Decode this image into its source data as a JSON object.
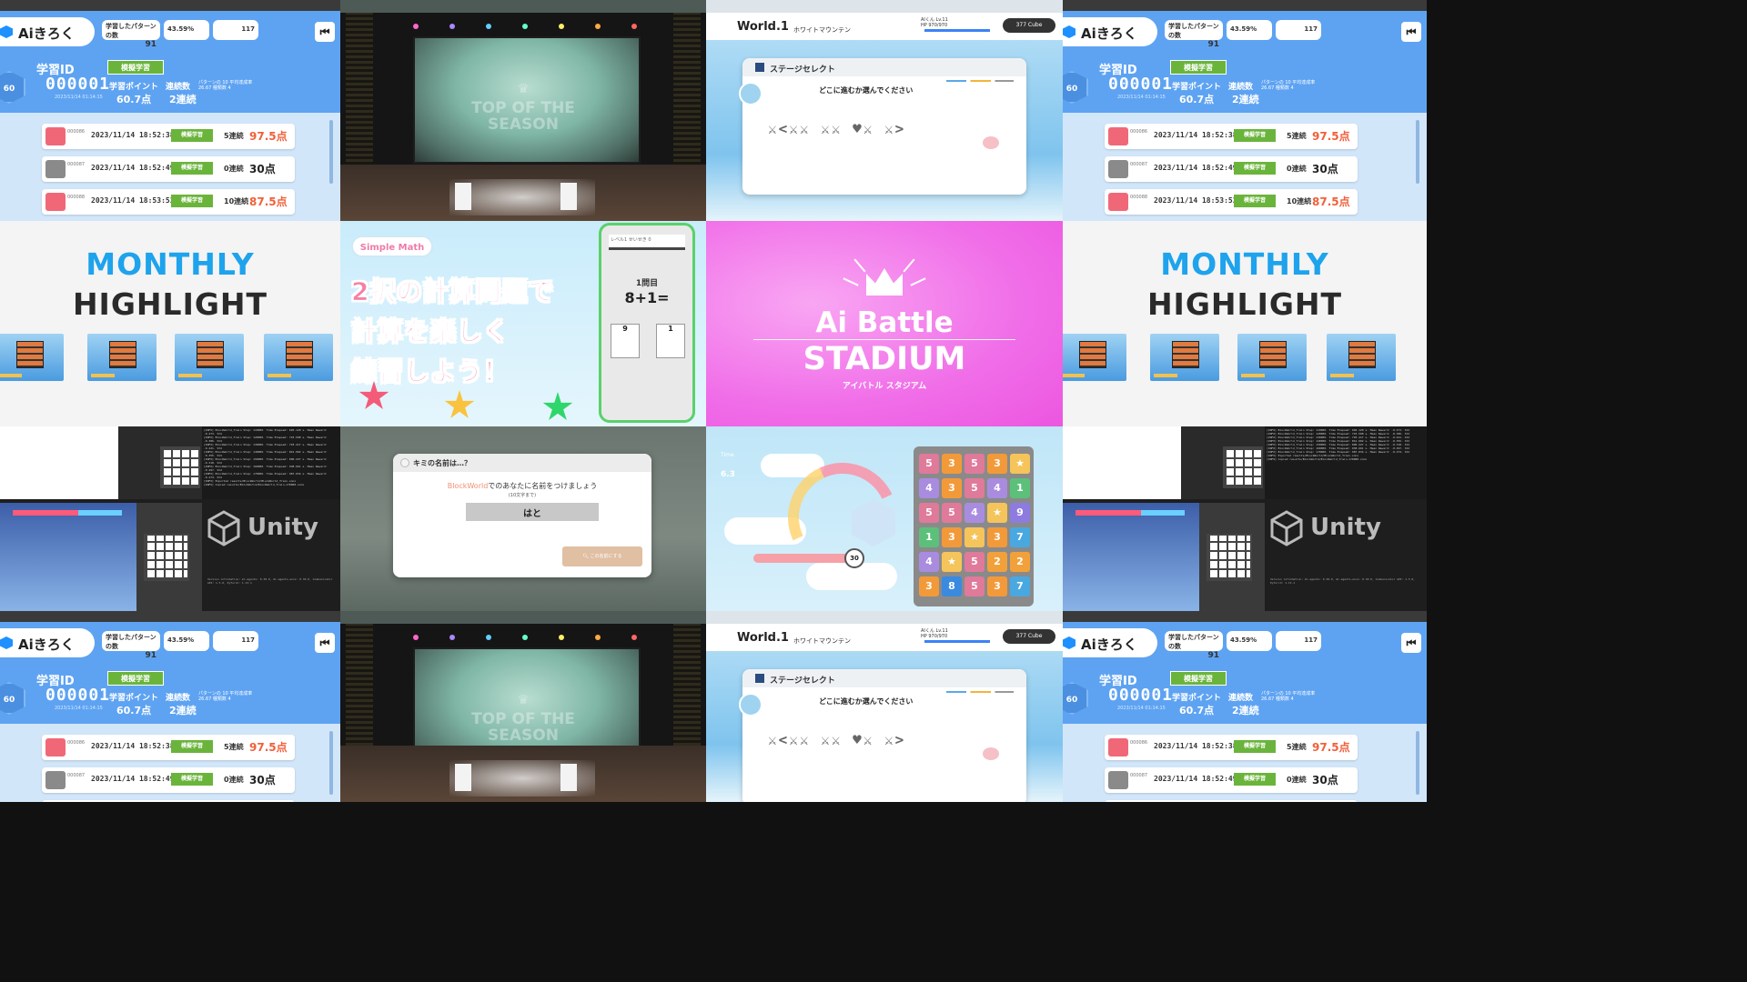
{
  "kiroku": {
    "app_name": "Aiきろく",
    "pill1_label": "学習したパターンの数",
    "pill1_value": "91",
    "pill2_value": "43.59%",
    "pill3_value": "117",
    "back_icon": "skip-back-icon",
    "level": "60",
    "id_label": "学習ID",
    "id_value": "000001",
    "id_date": "2023/11/14 01:14:15",
    "mode_tag": "模擬学習",
    "points_label": "学習ポイント",
    "points_value": "60.7点",
    "streak_label": "連続数",
    "streak_value": "2連続",
    "mini_stats": "パターンの 10 平均達成率 26.67 種類数 4",
    "records": [
      {
        "num": "000086",
        "datetime": "2023/11/14 18:52:38",
        "tag": "模擬学習",
        "streak": "5連続",
        "score": "97.5点",
        "score_color": "#f0603a",
        "icon_color": "#f06878"
      },
      {
        "num": "000087",
        "datetime": "2023/11/14 18:52:49",
        "tag": "模擬学習",
        "streak": "0連続",
        "score": "30点",
        "score_color": "#222222",
        "icon_color": "#8a8a8a"
      },
      {
        "num": "000088",
        "datetime": "2023/11/14 18:53:53",
        "tag": "模擬学習",
        "streak": "10連続",
        "score": "87.5点",
        "score_color": "#f0603a",
        "icon_color": "#f06878"
      }
    ]
  },
  "stage": {
    "crown_glyph": "♛",
    "title_line1": "TOP OF THE",
    "title_line2": "SEASON"
  },
  "world": {
    "title": "World.1",
    "subtitle": "ホワイトマウンテン",
    "player": "AIくん Lv.11",
    "hp": "HP 970/970",
    "cube": "377 Cube",
    "panel_title": "ステージセレクト",
    "question": "どこに進むか選んでください",
    "map_glyphs": "⚔<⚔⚔ ⚔⚔ ♥⚔ ⚔>"
  },
  "monthly": {
    "line1": "MONTHLY",
    "line2": "HIGHLIGHT"
  },
  "simple_math": {
    "logo": "Simple Math",
    "line1": "2択の計算問題で",
    "line2": "計算を楽しく",
    "line3": "練習しよう！",
    "phone_top": "レベル1 せいせき 0",
    "question_num": "1問目",
    "question_expr": "8+1=",
    "answer_left": "9",
    "answer_right": "1",
    "star_colors": [
      "#f45b78",
      "#f9c33f",
      "#2fd66b"
    ]
  },
  "stadium": {
    "line1": "Ai Battle",
    "line2": "STADIUM",
    "kana": "アイバトル スタジアム"
  },
  "unity": {
    "logo": "Unity",
    "console_lines": [
      "[INFO] BlockWorld_Train  Step: 110000. Time Elapsed: 695.120 s. Mean Reward: -0.473. Std",
      "[INFO] BlockWorld_Train  Step: 120000. Time Elapsed: 743.508 s. Mean Reward: -0.386. Std",
      "[INFO] BlockWorld_Train  Step: 130000. Time Elapsed: 793.417 s. Mean Reward: -0.421. Std",
      "[INFO] BlockWorld_Train  Step: 140000. Time Elapsed: 841.902 s. Mean Reward: -0.355. Std",
      "[INFO] BlockWorld_Train  Step: 150000. Time Elapsed: 890.227 s. Mean Reward: -0.318. Std",
      "[INFO] BlockWorld_Train  Step: 160000. Time Elapsed: 938.661 s. Mean Reward: -0.297. Std",
      "[INFO] BlockWorld_Train  Step: 170000. Time Elapsed: 987.034 s. Mean Reward: -0.274. Std",
      "[INFO] Exported results/BlockWorld/BlockWorld_Train.onnx",
      "[INFO] Copied results/BlockWorld/BlockWorld_Train-170000.onnx"
    ],
    "version_info": "Version information: ml-agents: 0.30.0, ml-agents-envs: 0.30.0, Communicator API: 1.5.0, PyTorch: 1.13.1"
  },
  "name_dialog": {
    "header": "キミの名前は…？",
    "message_brand": "BlockWorld",
    "message_rest": "でのあなたに名前をつけましょう",
    "sub": "(10文字まで)",
    "input_value": "はと",
    "button": "この名前にする"
  },
  "puzzle": {
    "time_label": "Time",
    "time_value": "6.3",
    "hp_value": "30",
    "grid": [
      [
        "5",
        "3",
        "5",
        "3",
        "★"
      ],
      [
        "4",
        "3",
        "5",
        "4",
        "1"
      ],
      [
        "5",
        "5",
        "4",
        "★",
        "9"
      ],
      [
        "1",
        "3",
        "★",
        "3",
        "7"
      ],
      [
        "4",
        "★",
        "5",
        "2",
        "2"
      ],
      [
        "3",
        "8",
        "5",
        "3",
        "7"
      ]
    ],
    "cell_colors": {
      "1": "#5cc07a",
      "2": "#f2a13a",
      "3": "#f29a3a",
      "4": "#a98ce0",
      "5": "#e07a9a",
      "7": "#4aa8e0",
      "8": "#3a8ae0",
      "9": "#8e7be0",
      "★": "#f5c45a"
    }
  }
}
